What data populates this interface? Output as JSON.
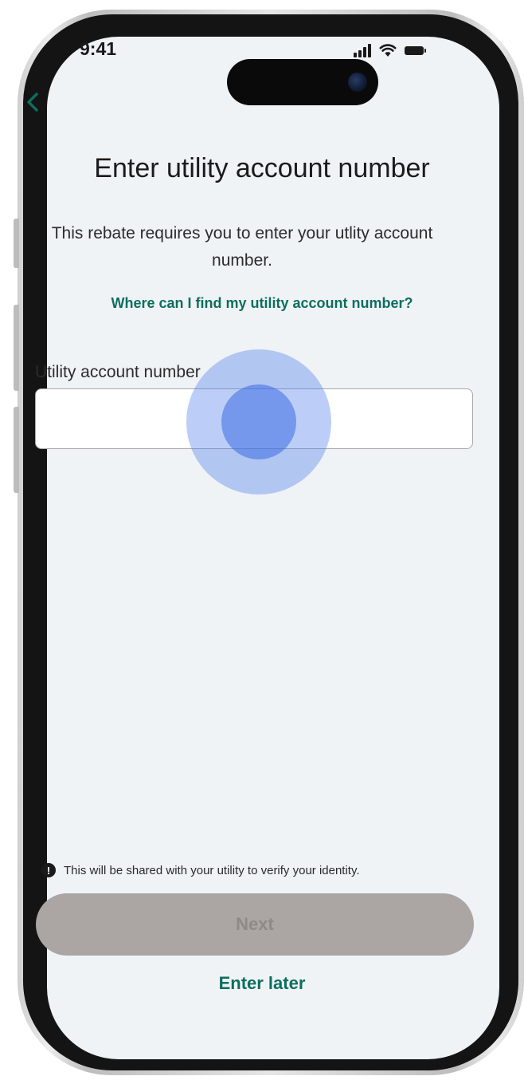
{
  "status_bar": {
    "time": "9:41",
    "icons": [
      "signal-icon",
      "wifi-icon",
      "battery-icon"
    ]
  },
  "nav": {
    "back_icon": "chevron-left-icon"
  },
  "header": {
    "title": "Enter utility account number",
    "subtitle": "This rebate requires you to enter your utlity account number.",
    "help_link": "Where can I find my utility account number?"
  },
  "form": {
    "label": "Utility account number",
    "value": "",
    "placeholder": ""
  },
  "footer": {
    "notice_icon": "info-icon",
    "notice_icon_glyph": "!",
    "notice_text": "This will be shared with your utility to verify your identity.",
    "next_label": "Next",
    "later_label": "Enter later"
  },
  "colors": {
    "accent": "#0d6e5e",
    "background": "#eff3f6",
    "button_disabled": "#aba6a4",
    "touch_indicator": "#4e7eec"
  }
}
